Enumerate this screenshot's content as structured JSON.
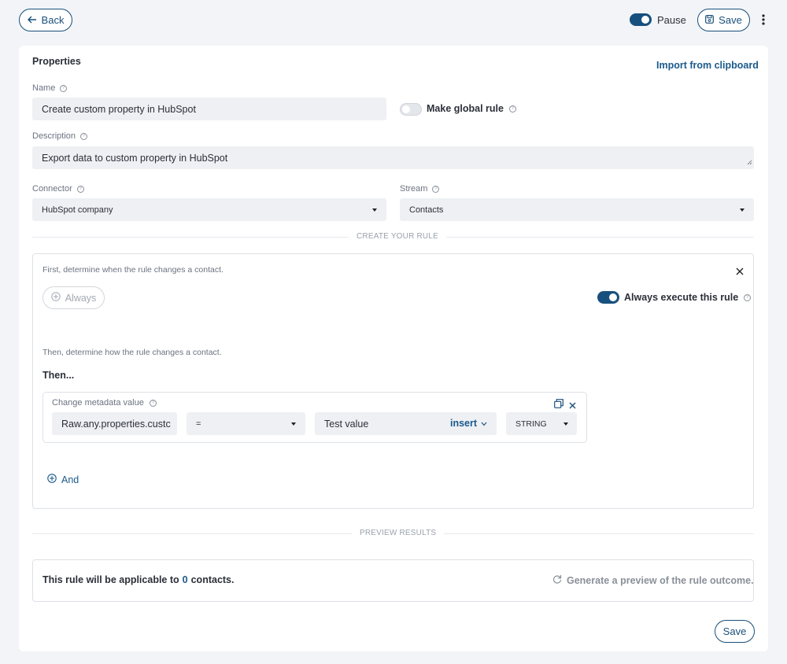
{
  "header": {
    "back_label": "Back",
    "pause_label": "Pause",
    "save_label": "Save"
  },
  "properties": {
    "title": "Properties",
    "import_label": "Import from clipboard",
    "name_label": "Name",
    "name_value": "Create custom property in HubSpot",
    "global_rule_label": "Make global rule",
    "description_label": "Description",
    "description_value": "Export data to custom property in HubSpot",
    "connector_label": "Connector",
    "connector_value": "HubSpot company",
    "stream_label": "Stream",
    "stream_value": "Contacts"
  },
  "rule": {
    "section_title": "CREATE YOUR RULE",
    "condition_hint": "First, determine when the rule changes a contact.",
    "always_label": "Always",
    "always_execute_label": "Always execute this rule",
    "action_hint": "Then, determine how the rule changes a contact.",
    "then_label": "Then...",
    "action": {
      "title": "Change metadata value",
      "field_value": "Raw.any.properties.custc",
      "operator_value": "=",
      "value_value": "Test value",
      "insert_label": "insert",
      "type_value": "STRING"
    },
    "and_label": "And"
  },
  "preview": {
    "section_title": "PREVIEW RESULTS",
    "text_before": "This rule will be applicable to",
    "count": "0",
    "text_after": "contacts.",
    "generate_label": "Generate a preview of the rule outcome."
  },
  "footer": {
    "save_label": "Save"
  }
}
